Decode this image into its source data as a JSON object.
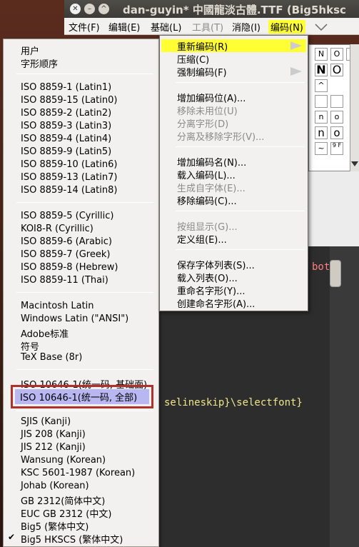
{
  "window": {
    "title": "dan-guyin*  中國龍淡古體.TTF (Big5hksc",
    "close_glyph": "✕",
    "min_glyph": "–",
    "max_glyph": "^"
  },
  "menubar": {
    "items": [
      {
        "label": "文件(F)"
      },
      {
        "label": "编辑(E)"
      },
      {
        "label": "基础(L)"
      },
      {
        "label": "工具(T)",
        "disabled": true
      },
      {
        "label": "消隐(I)"
      },
      {
        "label": "编码(N)",
        "active": true
      }
    ]
  },
  "encoding_submenu": {
    "groups": [
      [
        {
          "label": "重新编码(R)",
          "submenu": true,
          "active": true
        },
        {
          "label": "压缩(C)"
        },
        {
          "label": "强制编码(F)",
          "submenu": true
        }
      ],
      [
        {
          "label": "增加编码位(A)..."
        },
        {
          "label": "移除未用位(U)",
          "disabled": true
        },
        {
          "label": "分离字形(D)",
          "disabled": true
        },
        {
          "label": "分离及移除字形(V)...",
          "disabled": true
        }
      ],
      [
        {
          "label": "增加编码名(N)..."
        },
        {
          "label": "载入编码(L)..."
        },
        {
          "label": "生成自字体(E)...",
          "disabled": true
        },
        {
          "label": "移除编码(C)..."
        }
      ],
      [
        {
          "label": "按组显示(G)...",
          "disabled": true
        },
        {
          "label": "定义组(E)..."
        }
      ],
      [
        {
          "label": "保存字体列表(S)..."
        },
        {
          "label": "载入列表(O)..."
        },
        {
          "label": "重命名字形(Y)..."
        },
        {
          "label": "创建命名字形(A)..."
        }
      ]
    ]
  },
  "reencode_list": {
    "items": [
      "用户",
      "字形顺序",
      "ISO 8859-1  (Latin1)",
      "ISO 8859-15  (Latin0)",
      "ISO 8859-2  (Latin2)",
      "ISO 8859-3  (Latin3)",
      "ISO 8859-4  (Latin4)",
      "ISO 8859-9  (Latin5)",
      "ISO 8859-10  (Latin6)",
      "ISO 8859-13  (Latin7)",
      "ISO 8859-14  (Latin8)",
      "ISO 8859-5 (Cyrillic)",
      "KOI8-R (Cyrillic)",
      "ISO 8859-6 (Arabic)",
      "ISO 8859-7 (Greek)",
      "ISO 8859-8 (Hebrew)",
      "ISO 8859-11 (Thai)",
      "Macintosh Latin",
      "Windows Latin (\"ANSI\")",
      "Adobe标准",
      "符号",
      "TeX Base (8r)",
      "ISO 10646-1(统一码, 基础面)",
      "ISO 10646-1(统一码, 全部)",
      "SJIS (Kanji)",
      "JIS 208 (Kanji)",
      "JIS 212 (Kanji)",
      "Wansung (Korean)",
      "KSC 5601-1987 (Korean)",
      "Johab (Korean)",
      "GB 2312(简体中文)",
      "EUC GB 2312 (中文)",
      "Big5 (繁体中文)",
      "Big5 HKSCS (繁体中文)"
    ],
    "highlighted": "ISO 10646-1(统一码, 全部)",
    "checked": "Big5 HKSCS (繁体中文)",
    "check_glyph": "✔"
  },
  "glyph_grid": {
    "cells": [
      "N",
      "O",
      "",
      "N",
      "O",
      "^",
      "",
      "",
      "n",
      "o",
      "~",
      "9 F"
    ]
  },
  "editor": {
    "line1": "bot",
    "line2": "selineskip}\\selectfont}"
  }
}
